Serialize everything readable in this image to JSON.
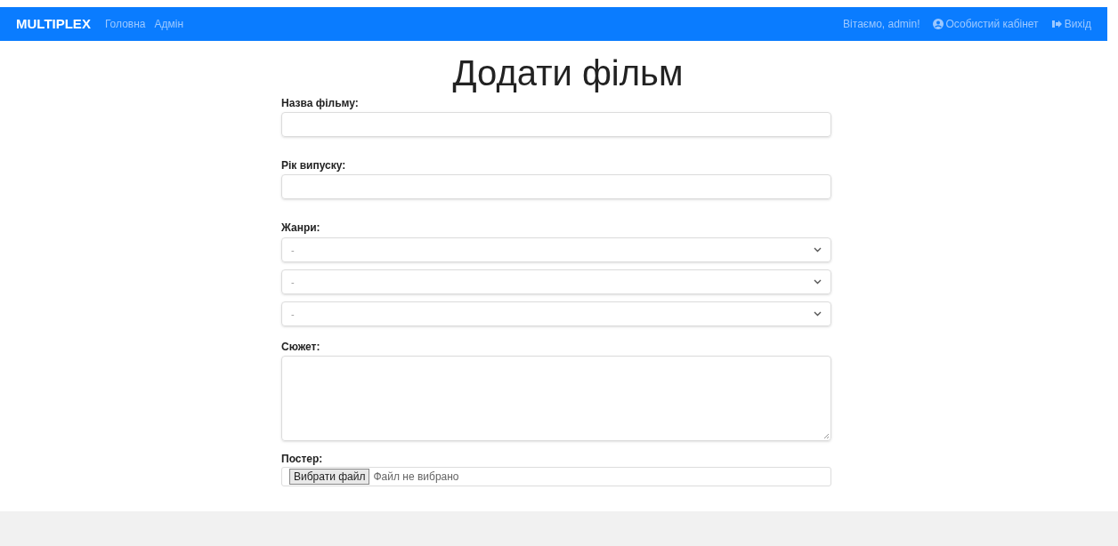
{
  "navbar": {
    "brand": "MULTIPLEX",
    "links": [
      {
        "label": "Головна"
      },
      {
        "label": "Адмін"
      }
    ],
    "greeting": "Вітаємо, admin!",
    "account_link": "Особистий кабінет",
    "logout_link": "Вихід"
  },
  "page_title": "Додати фільм",
  "form": {
    "fields": [
      {
        "kind": "text",
        "label": "Назва фільму:"
      },
      {
        "kind": "text",
        "label": "Рік випуску:"
      },
      {
        "kind": "selects",
        "label": "Жанри:",
        "options": [
          "-",
          "-",
          "-"
        ]
      },
      {
        "kind": "textarea",
        "label": "Сюжет:"
      },
      {
        "kind": "file",
        "label": "Постер:",
        "button": "Вибрати файл",
        "status": "Файл не вибрано"
      }
    ]
  }
}
